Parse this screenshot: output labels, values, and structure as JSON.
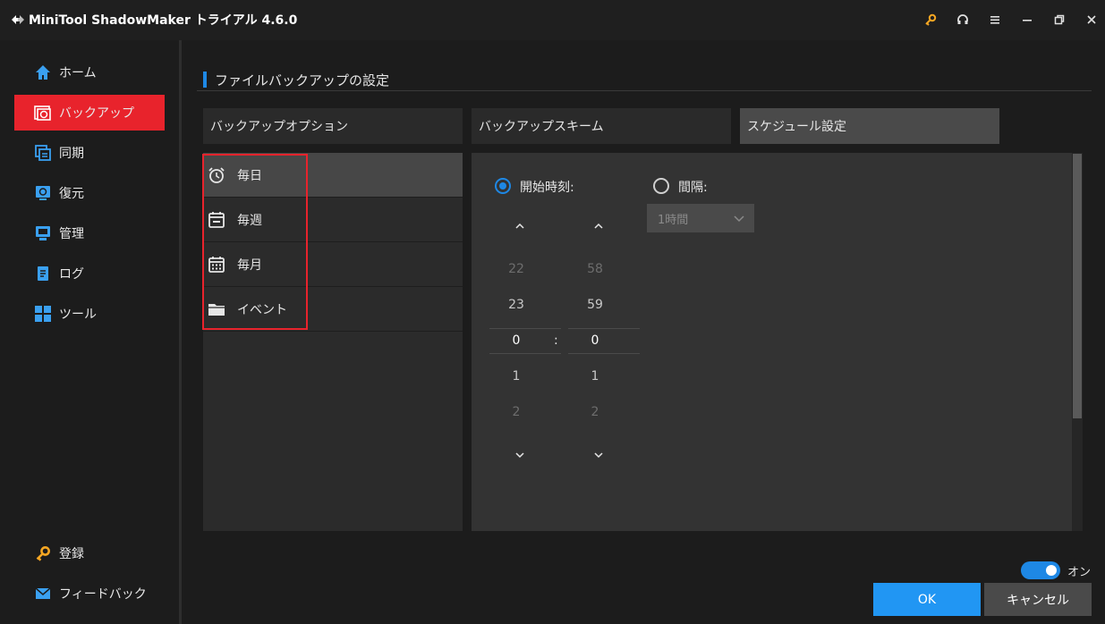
{
  "window": {
    "title": "MiniTool ShadowMaker トライアル 4.6.0"
  },
  "titlebar_icons": [
    "key-icon",
    "headset-icon",
    "menu-icon",
    "minimize-icon",
    "restore-icon",
    "close-icon"
  ],
  "sidebar": {
    "items": [
      {
        "label": "ホーム",
        "icon": "home-icon"
      },
      {
        "label": "バックアップ",
        "icon": "backup-icon",
        "active": true
      },
      {
        "label": "同期",
        "icon": "sync-icon"
      },
      {
        "label": "復元",
        "icon": "restore-data-icon"
      },
      {
        "label": "管理",
        "icon": "manage-icon"
      },
      {
        "label": "ログ",
        "icon": "log-icon"
      },
      {
        "label": "ツール",
        "icon": "tools-icon"
      }
    ],
    "bottom": [
      {
        "label": "登録",
        "icon": "register-key-icon"
      },
      {
        "label": "フィードバック",
        "icon": "mail-icon"
      }
    ]
  },
  "main": {
    "title": "ファイルバックアップの設定",
    "tabs": [
      {
        "label": "バックアップオプション"
      },
      {
        "label": "バックアップスキーム"
      },
      {
        "label": "スケジュール設定",
        "active": true
      }
    ],
    "frequency": [
      {
        "label": "毎日",
        "icon": "alarm-clock-icon",
        "selected": true
      },
      {
        "label": "毎週",
        "icon": "calendar-week-icon"
      },
      {
        "label": "毎月",
        "icon": "calendar-month-icon"
      },
      {
        "label": "イベント",
        "icon": "folder-icon"
      }
    ],
    "schedule": {
      "start_time_label": "開始時刻:",
      "interval_label": "間隔:",
      "start_time_checked": true,
      "interval_value": "1時間",
      "hours": {
        "prev2": "22",
        "prev1": "23",
        "current": "0",
        "next1": "1",
        "next2": "2"
      },
      "minutes": {
        "prev2": "58",
        "prev1": "59",
        "current": "0",
        "next1": "1",
        "next2": "2"
      },
      "separator": ":"
    }
  },
  "footer": {
    "toggle_label": "オン",
    "toggle_on": true,
    "ok_label": "OK",
    "cancel_label": "キャンセル"
  },
  "colors": {
    "accent": "#1e88e5",
    "active_nav": "#e8232c",
    "ok_button": "#2196f3"
  }
}
